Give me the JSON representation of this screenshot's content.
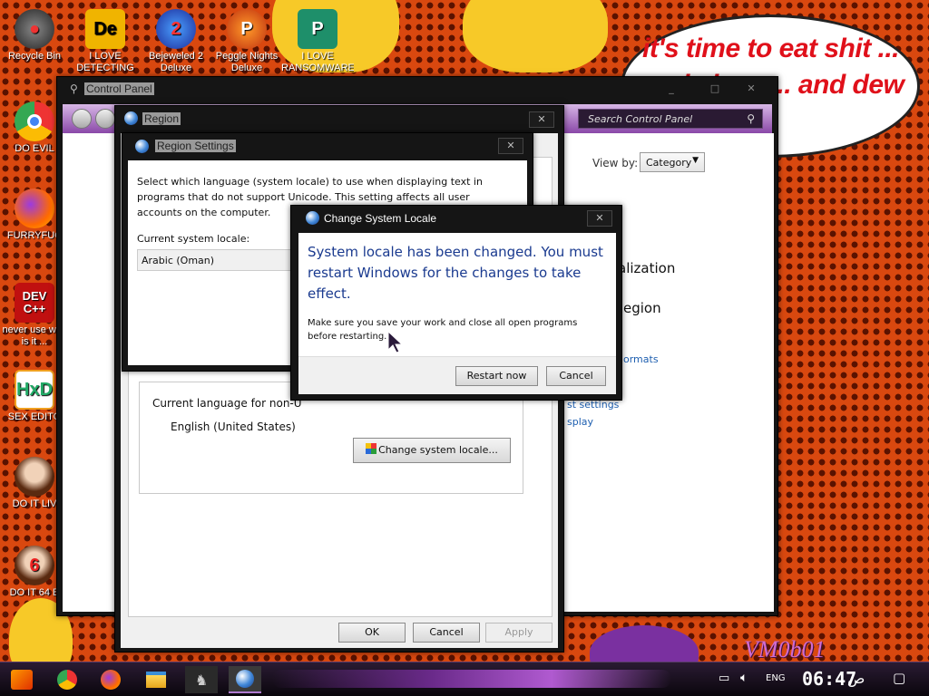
{
  "wallpaper": {
    "speech_bubble": "it's time to eat shit ... and chew ... and dew",
    "watermark": "VM0b01"
  },
  "desktop_icons": [
    {
      "label": "Recycle Bin",
      "icon": "recycle-bin-icon"
    },
    {
      "label": "I LOVE DETECTING",
      "icon": "detect-it-easy-icon"
    },
    {
      "label": "Bejeweled 2 Deluxe",
      "icon": "bejeweled-icon"
    },
    {
      "label": "Peggle Nights Deluxe",
      "icon": "peggle-icon"
    },
    {
      "label": "I LOVE RANSOMWARE",
      "icon": "publisher-icon"
    },
    {
      "label": "DO EVIL",
      "icon": "chrome-icon"
    },
    {
      "label": "FURRYFUC",
      "icon": "firefox-icon"
    },
    {
      "label": "never use why is it ...",
      "icon": "devcpp-icon"
    },
    {
      "label": "SEX EDITO",
      "icon": "hxd-icon"
    },
    {
      "label": "DO IT LIV",
      "icon": "portrait-icon"
    },
    {
      "label": "DO IT 64 B",
      "icon": "portrait-64-icon"
    }
  ],
  "control_panel": {
    "title": "Control Panel",
    "search_placeholder": "Search Control Panel",
    "view_by_label": "View by:",
    "view_by_value": "Category",
    "partial_items": [
      "alization",
      "egion",
      "ormats",
      "st settings",
      "splay"
    ]
  },
  "region": {
    "title": "Region",
    "group_label": "Current language for non-U",
    "language_value": "English (United States)",
    "change_locale_btn": "Change system locale...",
    "ok_btn": "OK",
    "cancel_btn": "Cancel",
    "apply_btn": "Apply"
  },
  "region_settings": {
    "title": "Region Settings",
    "description": "Select which language (system locale) to use when displaying text in programs that do not support Unicode. This setting affects all user accounts on the computer.",
    "current_locale_label": "Current system locale:",
    "current_locale_value": "Arabic (Oman)"
  },
  "change_locale_dialog": {
    "title": "Change System Locale",
    "headline": "System locale has been changed. You must restart Windows for the changes to take effect.",
    "body": "Make sure you save your work and close all open programs before restarting.",
    "restart_btn": "Restart now",
    "cancel_btn": "Cancel"
  },
  "taskbar": {
    "pinned": [
      "start-icon",
      "chrome-icon",
      "firefox-icon",
      "file-explorer-icon",
      "cursor-app-icon",
      "control-panel-icon"
    ],
    "language": "ENG",
    "time": "06:47",
    "ampm": "ص"
  },
  "colors": {
    "accent_purple": "#7a2a9a",
    "dialog_heading_blue": "#1a3a8f",
    "wallpaper_orange": "#d9480f"
  }
}
